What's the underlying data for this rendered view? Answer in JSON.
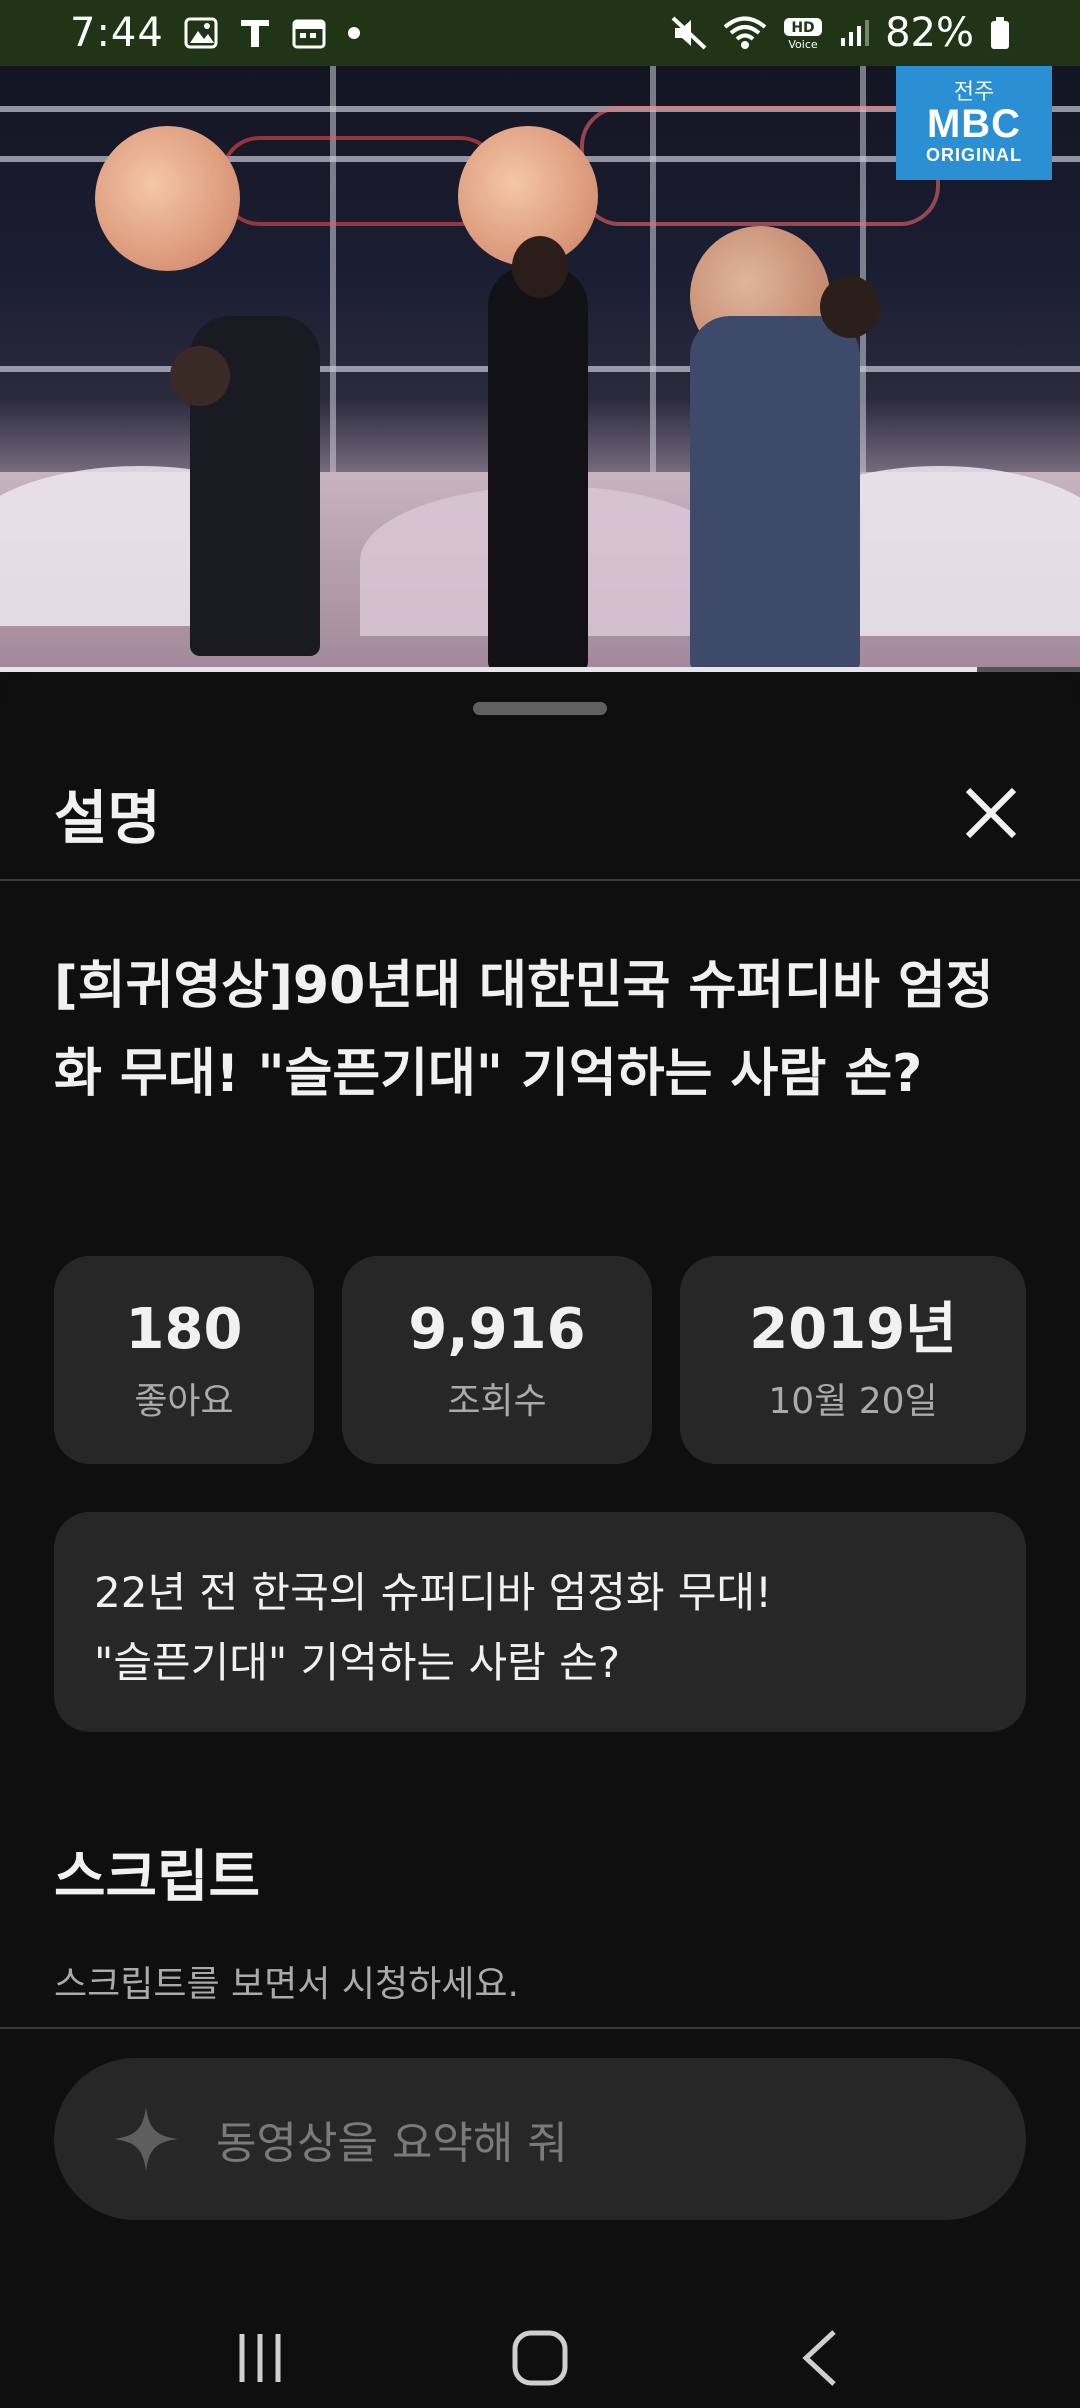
{
  "status_bar": {
    "time": "7:44",
    "battery": "82%",
    "icons_left": [
      "image-icon",
      "text-icon",
      "calendar-icon",
      "dot-icon"
    ],
    "icons_right": [
      "mute-icon",
      "wifi-icon",
      "hd-voice-icon",
      "signal-icon",
      "battery-icon"
    ]
  },
  "video": {
    "channel_logo_top": "전주",
    "channel_logo_main": "MBC",
    "channel_logo_sub": "ORIGINAL",
    "progress_fraction": 0.905
  },
  "sheet": {
    "title": "설명",
    "close_icon": "close-icon",
    "video_title": "[희귀영상]90년대 대한민국 슈퍼디바 엄정화 무대! \"슬픈기대\" 기억하는 사람 손?",
    "stats": [
      {
        "value": "180",
        "label": "좋아요"
      },
      {
        "value": "9,916",
        "label": "조회수"
      },
      {
        "value": "2019년",
        "label": "10월 20일"
      }
    ],
    "description": "22년 전 한국의 슈퍼디바 엄정화 무대!\n \"슬픈기대\" 기억하는 사람 손?",
    "script_heading": "스크립트",
    "script_sub": "스크립트를 보면서 시청하세요.",
    "summary_placeholder": "동영상을 요약해 줘",
    "summary_icon": "sparkle-icon"
  },
  "nav": {
    "items": [
      "recent-apps-icon",
      "home-icon",
      "back-icon"
    ]
  }
}
